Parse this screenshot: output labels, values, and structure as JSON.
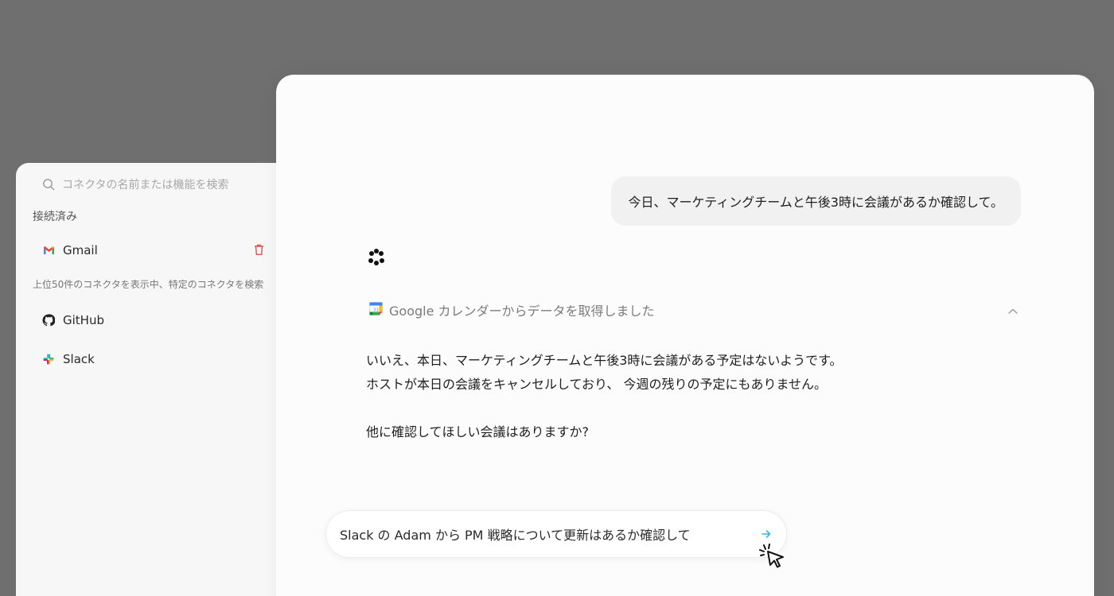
{
  "connectors_panel": {
    "search": {
      "placeholder": "コネクタの名前または機能を検索",
      "icon": "search-icon"
    },
    "connected_label": "接続済み",
    "connected": [
      {
        "name": "Gmail",
        "icon": "gmail-icon",
        "action_icon": "trash-icon"
      }
    ],
    "hint": "上位50件のコネクタを表示中、特定のコネクタを検索",
    "available": [
      {
        "name": "GitHub",
        "icon": "github-icon"
      },
      {
        "name": "Slack",
        "icon": "slack-icon"
      }
    ]
  },
  "chat": {
    "user_message": "今日、マーケティングチームと午後3時に会議があるか確認して。",
    "tool_call": {
      "icon": "google-calendar-icon",
      "label": "Google カレンダーからデータを取得しました",
      "toggle_icon": "chevron-up-icon"
    },
    "answer": {
      "line1": "いいえ、本日、マーケティングチームと午後3時に会議がある予定はないようです。",
      "line2": "ホストが本日の会議をキャンセルしており、 今週の残りの予定にもありません。",
      "line3": "他に確認してほしい会議はありますか?"
    },
    "composer": {
      "text": "Slack の Adam から PM 戦略について更新はあるか確認して",
      "send_icon": "arrow-right-icon"
    }
  },
  "colors": {
    "backdrop": "#6f6f6f",
    "panel": "#f7f7f7",
    "chat_bg": "#fcfcfc",
    "bubble": "#f1f1f1",
    "trash": "#e0524d",
    "send_arrow": "#3bb4e8"
  }
}
